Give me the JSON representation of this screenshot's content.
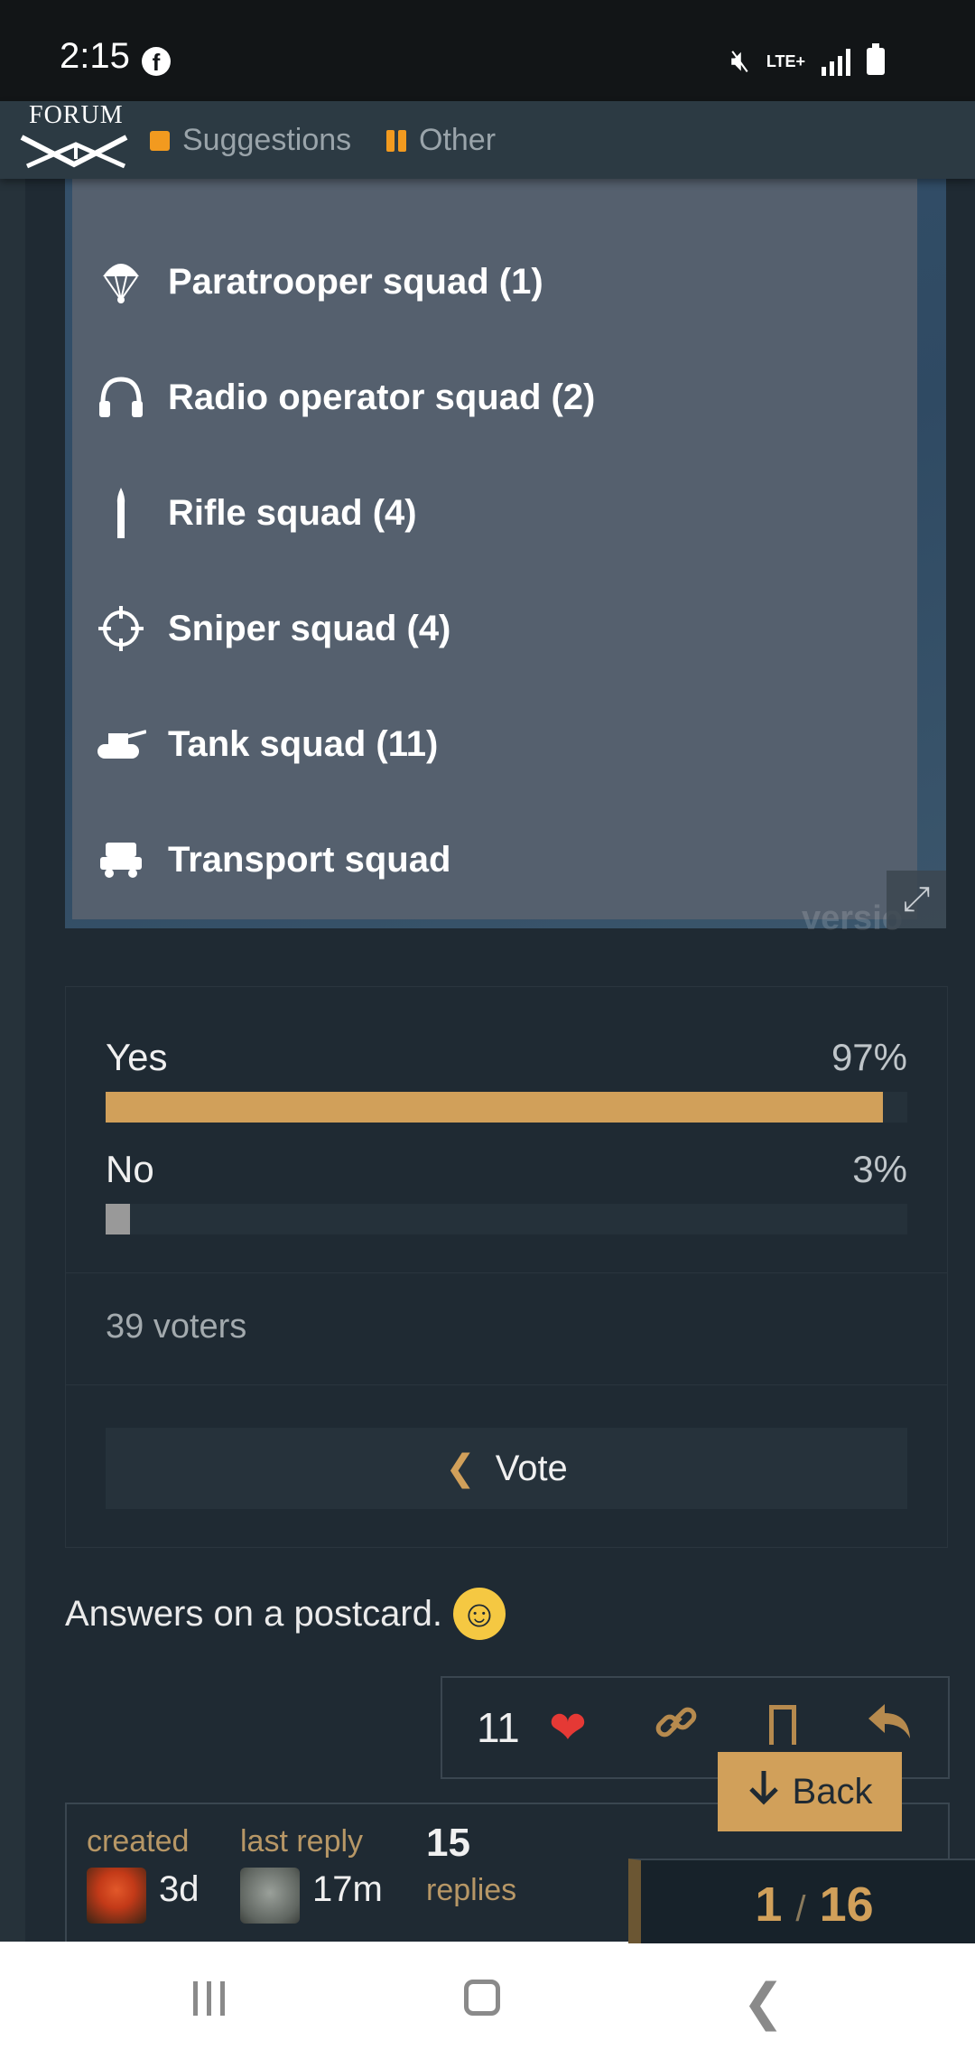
{
  "status_bar": {
    "time": "2:15",
    "network": "LTE+"
  },
  "header": {
    "logo_text": "FORUM",
    "categories": [
      {
        "label": "Suggestions",
        "color": "#f29a1f"
      },
      {
        "label": "Other",
        "color": "#f29a1f"
      }
    ]
  },
  "squads": [
    {
      "icon": "parachute-icon",
      "label": "Paratrooper squad (1)"
    },
    {
      "icon": "headphones-icon",
      "label": "Radio operator squad (2)"
    },
    {
      "icon": "bullet-icon",
      "label": "Rifle squad (4)"
    },
    {
      "icon": "crosshair-icon",
      "label": "Sniper squad (4)"
    },
    {
      "icon": "tank-icon",
      "label": "Tank squad (11)"
    },
    {
      "icon": "truck-icon",
      "label": "Transport squad"
    }
  ],
  "image_watermark": "versio",
  "poll": {
    "options": [
      {
        "label": "Yes",
        "percent_text": "97%",
        "percent": 97,
        "color": "#d1a05a"
      },
      {
        "label": "No",
        "percent_text": "3%",
        "percent": 3,
        "color": "#999999"
      }
    ],
    "voters": "39 voters",
    "vote_button": "Vote"
  },
  "post": {
    "text": "Answers on a postcard."
  },
  "actions": {
    "like_count": "11"
  },
  "back_button": "Back",
  "topic_map": {
    "created_label": "created",
    "created_value": "3d",
    "last_reply_label": "last reply",
    "last_reply_value": "17m",
    "replies_count": "15",
    "replies_label": "replies"
  },
  "progress": {
    "current": "1",
    "total": "16"
  }
}
